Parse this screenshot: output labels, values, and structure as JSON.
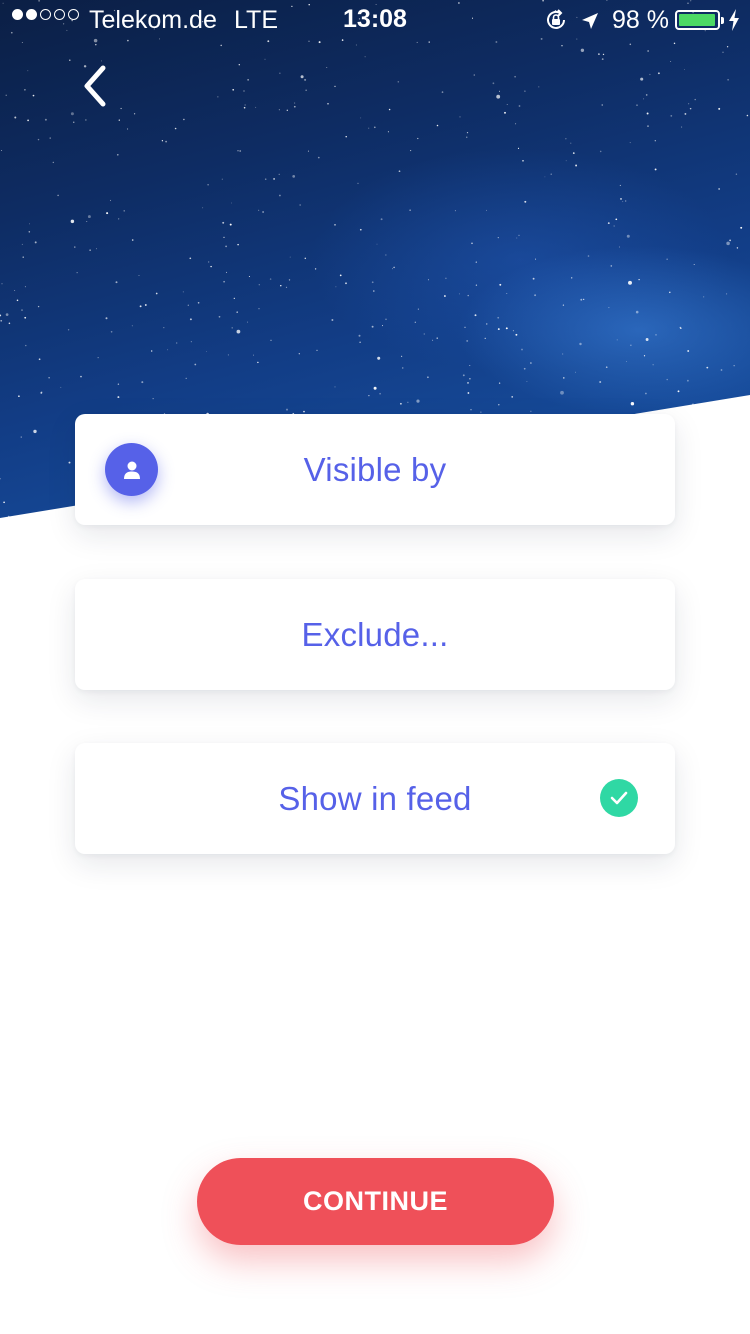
{
  "status_bar": {
    "carrier": "Telekom.de",
    "network": "LTE",
    "time": "13:08",
    "battery_percent": "98 %",
    "battery_level": 0.98,
    "signal_bars_filled": 2,
    "signal_bars_total": 5,
    "icons": [
      "orientation-lock-icon",
      "location-arrow-icon",
      "battery-icon",
      "charging-bolt-icon"
    ]
  },
  "header": {
    "back_icon": "chevron-left-icon"
  },
  "options": [
    {
      "label": "Visible by",
      "icon": "person-icon",
      "accent": "#5661e8"
    },
    {
      "label": "Exclude..."
    },
    {
      "label": "Show in feed",
      "checked": true,
      "check_icon": "checkmark-icon",
      "check_color": "#2fd8a4"
    }
  ],
  "continue_button": {
    "label": "CONTINUE",
    "color": "#ef5059"
  },
  "colors": {
    "label": "#5661e8",
    "battery_fill": "#4cd964"
  }
}
